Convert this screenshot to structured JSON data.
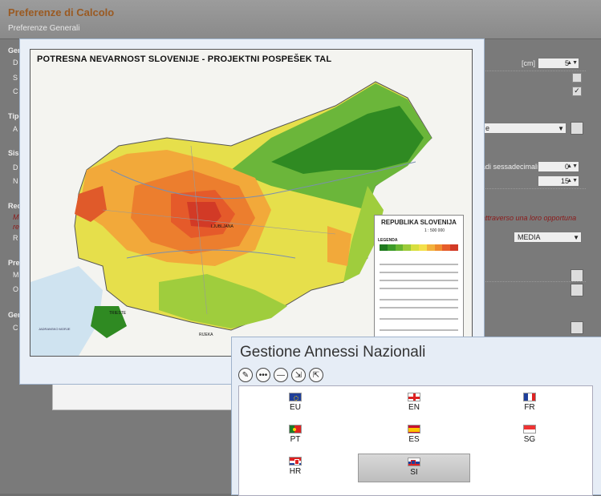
{
  "app": {
    "title": "Preferenze di Calcolo",
    "subtitle": "Preferenze Generali"
  },
  "background_form": {
    "sections": [
      "Gen",
      "Tipo",
      "Sism",
      "Rec",
      "Pre",
      "Gen"
    ],
    "row_letters": [
      "D",
      "S",
      "C",
      "A",
      "D",
      "N",
      "M",
      "R",
      "M",
      "O",
      "C"
    ],
    "unit_cm": "[cm]",
    "spin1_value": "5",
    "spin2_value": "0",
    "spin3_value": "15",
    "sessadecimali_text": "adi sessadecimali]",
    "italic_note": "attraverso una loro opportuna",
    "italic_note_left": "M",
    "italic_note_left2": "re",
    "media_value": "MEDIA",
    "dropdown_tail": "e"
  },
  "map": {
    "title": "POTRESNA NEVARNOST SLOVENIJE - PROJEKTNI POSPEŠEK TAL",
    "legend_country": "REPUBLIKA SLOVENIJA",
    "legend_scale": "1 : 500 000",
    "legend_label": "LEGENDA",
    "legend_colors": [
      "#1f7a1f",
      "#3d9b2a",
      "#68b531",
      "#9ccb3a",
      "#d8df3f",
      "#f4e04a",
      "#f3b13c",
      "#ef8a2e",
      "#e65c2a",
      "#d23a26"
    ],
    "cities": [
      "LJUBLJANA",
      "TRIESTE",
      "RIJEKA",
      "JADRANSKO MORJE"
    ]
  },
  "annex_dialog": {
    "title": "Gestione Annessi Nazionali",
    "toolbar": [
      {
        "name": "edit-icon",
        "glyph": "✎"
      },
      {
        "name": "more-icon",
        "glyph": "•••"
      },
      {
        "name": "remove-icon",
        "glyph": "—"
      },
      {
        "name": "export-icon",
        "glyph": "⇲"
      },
      {
        "name": "import-icon",
        "glyph": "⇱"
      }
    ],
    "items": [
      {
        "code": "EU",
        "flag": "eu"
      },
      {
        "code": "EN",
        "flag": "en"
      },
      {
        "code": "FR",
        "flag": "fr"
      },
      {
        "code": "PT",
        "flag": "pt"
      },
      {
        "code": "ES",
        "flag": "es"
      },
      {
        "code": "SG",
        "flag": "sg"
      },
      {
        "code": "HR",
        "flag": "hr"
      },
      {
        "code": "SI",
        "flag": "si",
        "selected": true
      }
    ]
  }
}
